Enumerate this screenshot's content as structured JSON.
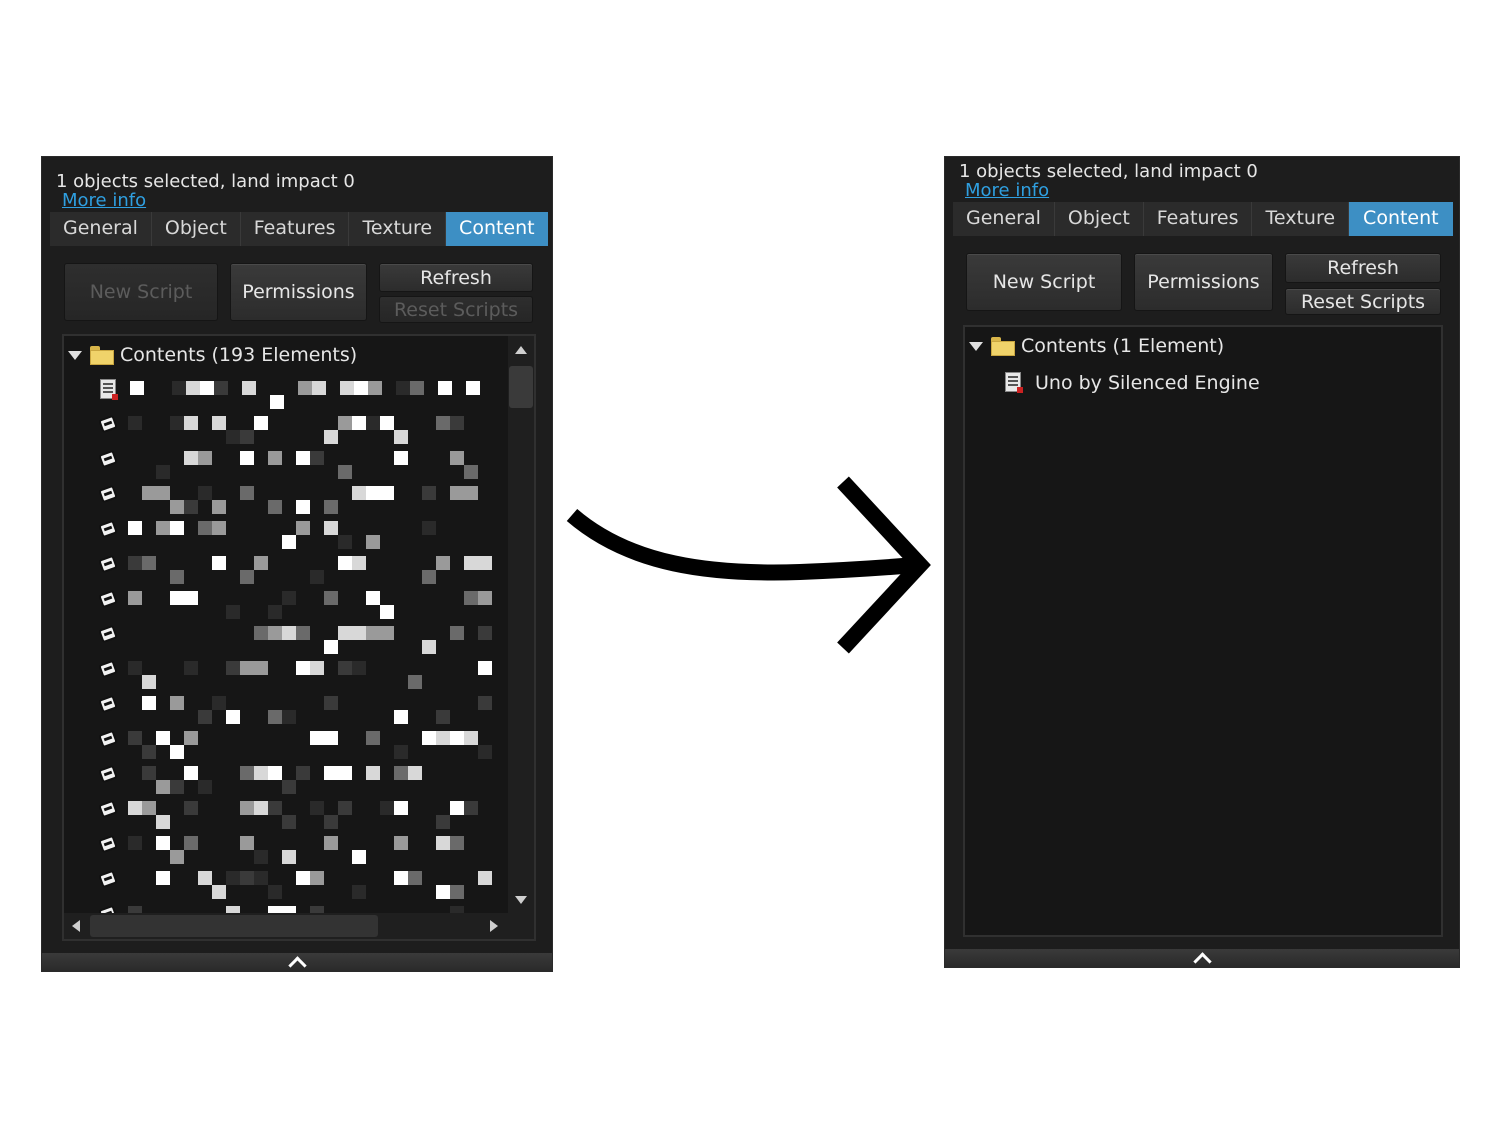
{
  "before": {
    "selection_text": "1 objects selected, land impact 0",
    "more_info": "More info",
    "tabs": [
      {
        "label": "General",
        "active": false
      },
      {
        "label": "Object",
        "active": false
      },
      {
        "label": "Features",
        "active": false
      },
      {
        "label": "Texture",
        "active": false
      },
      {
        "label": "Content",
        "active": true
      }
    ],
    "buttons": {
      "new_script": "New Script",
      "permissions": "Permissions",
      "refresh": "Refresh",
      "reset_scripts": "Reset Scripts"
    },
    "new_script_disabled": true,
    "reset_scripts_disabled": true,
    "contents_label": "Contents (193 Elements)",
    "item_names_obscured": true
  },
  "after": {
    "selection_text": "1 objects selected, land impact 0",
    "more_info": "More info",
    "tabs": [
      {
        "label": "General",
        "active": false
      },
      {
        "label": "Object",
        "active": false
      },
      {
        "label": "Features",
        "active": false
      },
      {
        "label": "Texture",
        "active": false
      },
      {
        "label": "Content",
        "active": true
      }
    ],
    "buttons": {
      "new_script": "New Script",
      "permissions": "Permissions",
      "refresh": "Refresh",
      "reset_scripts": "Reset Scripts"
    },
    "contents_label": "Contents (1 Element)",
    "items": [
      {
        "name": "Uno by Silenced Engine",
        "icon": "script-icon"
      }
    ]
  },
  "colors": {
    "panel_bg": "#1d1d1d",
    "active_tab": "#3d8fc4",
    "link": "#2f9fe0"
  }
}
